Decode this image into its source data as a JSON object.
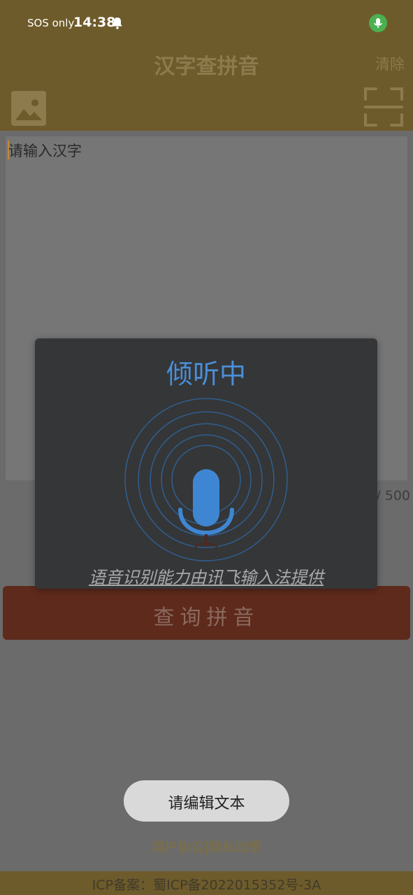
{
  "status_bar": {
    "carrier": "SOS only",
    "time": "14:38",
    "notification_icon": "bell-icon",
    "mic_indicator_icon": "microphone-icon",
    "mic_indicator_color": "#4caf50"
  },
  "header": {
    "title": "汉字查拼音",
    "clear_label": "清除",
    "image_button_icon": "image-icon",
    "scan_button_icon": "scan-icon",
    "background_color": "#6e5b2b"
  },
  "input": {
    "placeholder": "请输入汉字",
    "counter": "0 / 500"
  },
  "query_button": {
    "label": "查询拼音",
    "color": "#5e2a1c"
  },
  "toast": {
    "message": "请编辑文本"
  },
  "links": {
    "text": "用户协议|隐私政策"
  },
  "footer": {
    "icp": "ICP备案：蜀ICP备2022015352号-3A"
  },
  "voice_dialog": {
    "title": "倾听中",
    "icon": "microphone-icon",
    "credit": "语音识别能力由讯飞输入法提供",
    "accent_color": "#4a8fd8"
  }
}
